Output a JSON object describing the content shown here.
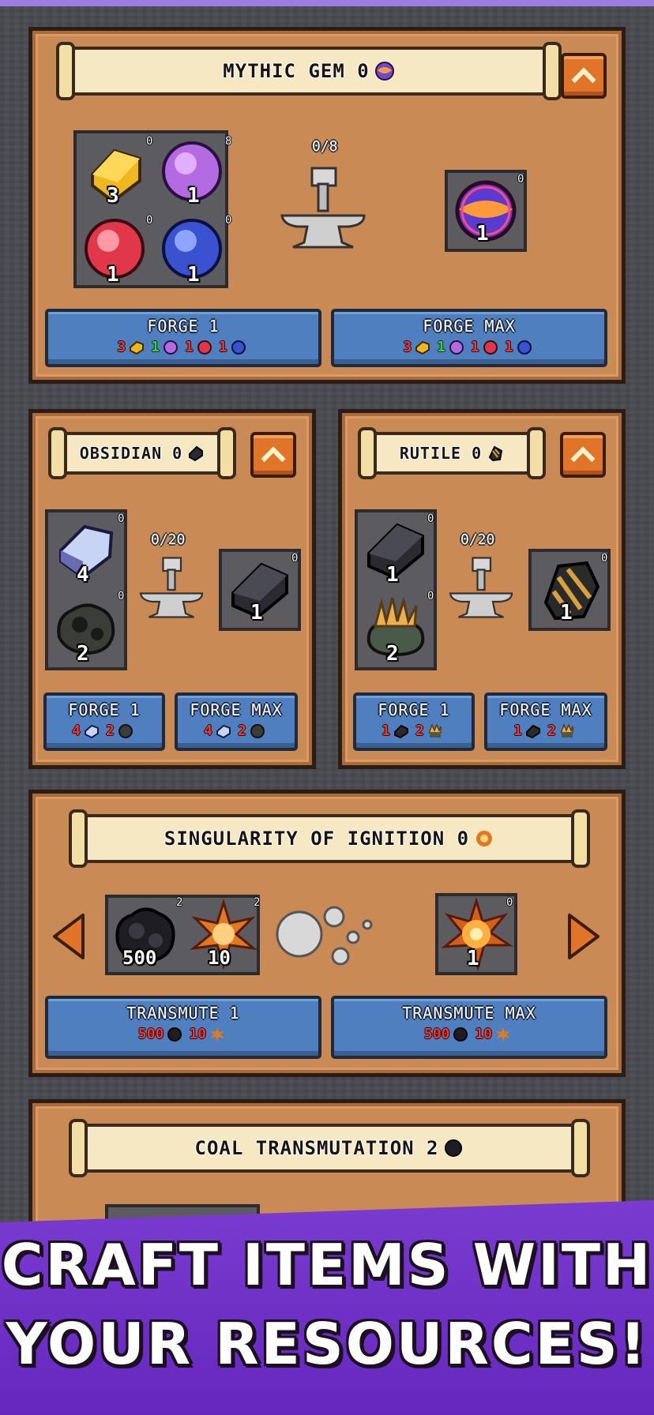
{
  "banner": {
    "line1": "CRAFT ITEMS WITH",
    "line2": "YOUR RESOURCES!"
  },
  "mythic": {
    "title": "MYTHIC GEM 0",
    "progress": "0/8",
    "inputs": [
      {
        "icon": "gold-ingot-icon",
        "count": "0",
        "qty": "3"
      },
      {
        "icon": "purple-orb-icon",
        "count": "8",
        "qty": "1"
      },
      {
        "icon": "red-orb-icon",
        "count": "0",
        "qty": "1"
      },
      {
        "icon": "blue-orb-icon",
        "count": "0",
        "qty": "1"
      }
    ],
    "output": {
      "icon": "mythic-gem-icon",
      "count": "0",
      "qty": "1"
    },
    "forge1": {
      "label": "FORGE 1",
      "costs": [
        "3",
        "1",
        "1",
        "1"
      ]
    },
    "forgemax": {
      "label": "FORGE MAX",
      "costs": [
        "3",
        "1",
        "1",
        "1"
      ]
    }
  },
  "obsidian": {
    "title": "OBSIDIAN 0",
    "progress": "0/20",
    "inputs": [
      {
        "icon": "iron-ingot-icon",
        "count": "0",
        "qty": "4"
      },
      {
        "icon": "coal-ore-icon",
        "count": "0",
        "qty": "2"
      }
    ],
    "output": {
      "icon": "obsidian-icon",
      "count": "0",
      "qty": "1"
    },
    "forge1": {
      "label": "FORGE 1",
      "costs": [
        "4",
        "2"
      ]
    },
    "forgemax": {
      "label": "FORGE MAX",
      "costs": [
        "4",
        "2"
      ]
    }
  },
  "rutile": {
    "title": "RUTILE 0",
    "progress": "0/20",
    "inputs": [
      {
        "icon": "obsidian-icon",
        "count": "0",
        "qty": "1"
      },
      {
        "icon": "gold-ore-icon",
        "count": "0",
        "qty": "2"
      }
    ],
    "output": {
      "icon": "rutile-icon",
      "count": "0",
      "qty": "1"
    },
    "forge1": {
      "label": "FORGE 1",
      "costs": [
        "1",
        "2"
      ]
    },
    "forgemax": {
      "label": "FORGE MAX",
      "costs": [
        "1",
        "2"
      ]
    }
  },
  "singularity": {
    "title": "SINGULARITY OF IGNITION 0",
    "inputs": [
      {
        "icon": "coal-icon",
        "count": "2",
        "qty": "500"
      },
      {
        "icon": "ember-icon",
        "count": "2",
        "qty": "10"
      }
    ],
    "output": {
      "icon": "ignition-icon",
      "count": "0",
      "qty": "1"
    },
    "t1": {
      "label": "TRANSMUTE 1",
      "costs": [
        "500",
        "10"
      ]
    },
    "tmax": {
      "label": "TRANSMUTE MAX",
      "costs": [
        "500",
        "10"
      ]
    }
  },
  "coal": {
    "title": "COAL TRANSMUTATION 2"
  }
}
